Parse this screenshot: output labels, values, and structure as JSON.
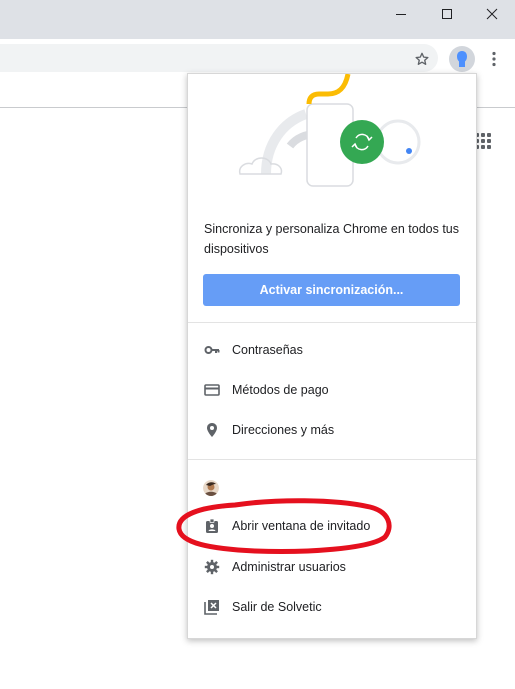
{
  "window": {
    "minimize_icon": "minimize-icon",
    "maximize_icon": "maximize-icon",
    "close_icon": "close-icon"
  },
  "toolbar": {
    "star_icon": "star-icon",
    "profile_icon": "profile-avatar-icon",
    "menu_icon": "more-vert-icon"
  },
  "apps_icon": "apps-grid-icon",
  "profile_menu": {
    "sync_promo": "Sincroniza y personaliza Chrome en todos tus dispositivos",
    "sync_button": "Activar sincronización...",
    "items": [
      {
        "label": "Contraseñas",
        "icon": "key-icon"
      },
      {
        "label": "Métodos de pago",
        "icon": "credit-card-icon"
      },
      {
        "label": "Direcciones y más",
        "icon": "location-pin-icon"
      }
    ],
    "profile_avatar_icon": "user-photo-icon",
    "profile_actions": [
      {
        "label": "Abrir ventana de invitado",
        "icon": "guest-badge-icon"
      },
      {
        "label": "Administrar usuarios",
        "icon": "gear-icon"
      },
      {
        "label": "Salir de Solvetic",
        "icon": "exit-profile-icon"
      }
    ]
  },
  "colors": {
    "sync_button_bg": "#669df6",
    "highlight_circle": "#e5101e",
    "illustration_green": "#34a853",
    "illustration_yellow": "#fbbc04"
  }
}
